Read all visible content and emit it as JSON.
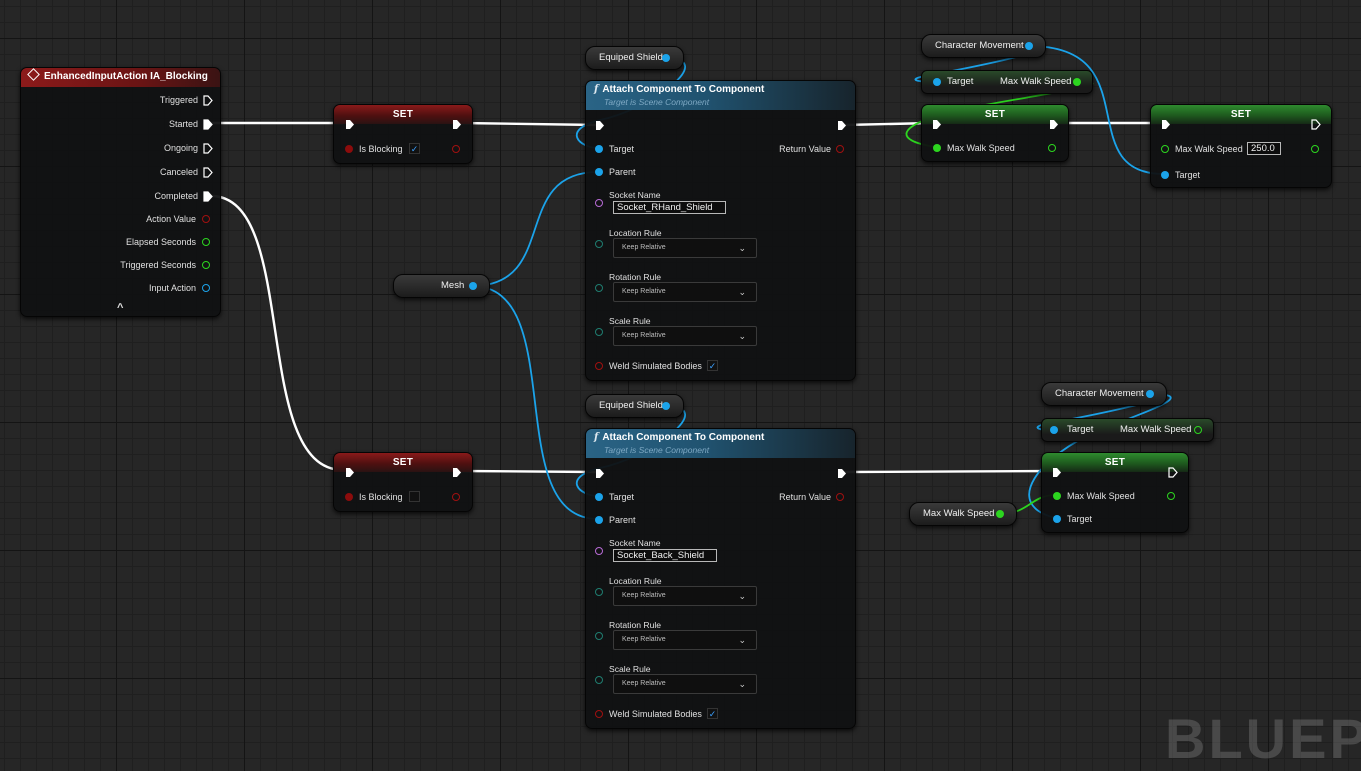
{
  "event_node": {
    "title": "EnhancedInputAction IA_Blocking",
    "pins": [
      "Triggered",
      "Started",
      "Ongoing",
      "Canceled",
      "Completed",
      "Action Value",
      "Elapsed Seconds",
      "Triggered Seconds",
      "Input Action"
    ],
    "collapse_glyph": "^"
  },
  "set_blocking_1": {
    "title": "SET",
    "var_label": "Is Blocking",
    "checked": "✓"
  },
  "set_blocking_2": {
    "title": "SET",
    "var_label": "Is Blocking",
    "checked": ""
  },
  "mesh_var": {
    "label": "Mesh"
  },
  "equiped_shield_1": {
    "label": "Equiped Shield"
  },
  "equiped_shield_2": {
    "label": "Equiped Shield"
  },
  "attach_1": {
    "title": "Attach Component To Component",
    "subtitle": "Target is Scene Component",
    "target_label": "Target",
    "parent_label": "Parent",
    "return_label": "Return Value",
    "socket_label": "Socket Name",
    "socket_value": "Socket_RHand_Shield",
    "location_label": "Location Rule",
    "location_value": "Keep Relative",
    "rotation_label": "Rotation Rule",
    "rotation_value": "Keep Relative",
    "scale_label": "Scale Rule",
    "scale_value": "Keep Relative",
    "weld_label": "Weld Simulated Bodies",
    "weld_checked": "✓"
  },
  "attach_2": {
    "title": "Attach Component To Component",
    "subtitle": "Target is Scene Component",
    "target_label": "Target",
    "parent_label": "Parent",
    "return_label": "Return Value",
    "socket_label": "Socket Name",
    "socket_value": "Socket_Back_Shield",
    "location_label": "Location Rule",
    "location_value": "Keep Relative",
    "rotation_label": "Rotation Rule",
    "rotation_value": "Keep Relative",
    "scale_label": "Scale Rule",
    "scale_value": "Keep Relative",
    "weld_label": "Weld Simulated Bodies",
    "weld_checked": "✓"
  },
  "char_movement_1": {
    "label": "Character Movement"
  },
  "get_mws_1": {
    "target_label": "Target",
    "out_label": "Max Walk Speed"
  },
  "set_mws_1": {
    "title": "SET",
    "in_label": "Max Walk Speed"
  },
  "set_mws_final": {
    "title": "SET",
    "in_label": "Max Walk Speed",
    "value": "250.0",
    "target_label": "Target"
  },
  "char_movement_2": {
    "label": "Character Movement"
  },
  "get_mws_2": {
    "target_label": "Target",
    "out_label": "Max Walk Speed"
  },
  "set_mws_2": {
    "title": "SET",
    "in_label": "Max Walk Speed",
    "target_label": "Target"
  },
  "mws_var": {
    "label": "Max Walk Speed"
  },
  "watermark": "BLUEPR",
  "colors": {
    "exec_wire": "#ffffff",
    "object_wire": "#1ba3ea",
    "float_wire": "#2cd51f",
    "bool_pin": "#8c0c0c",
    "name_pin": "#b86bd6",
    "event_header": "#8c1a1a",
    "function_header": "#2a6486",
    "set_header_bool": "#8a1a1a",
    "set_header_float": "#2e8b2e"
  }
}
